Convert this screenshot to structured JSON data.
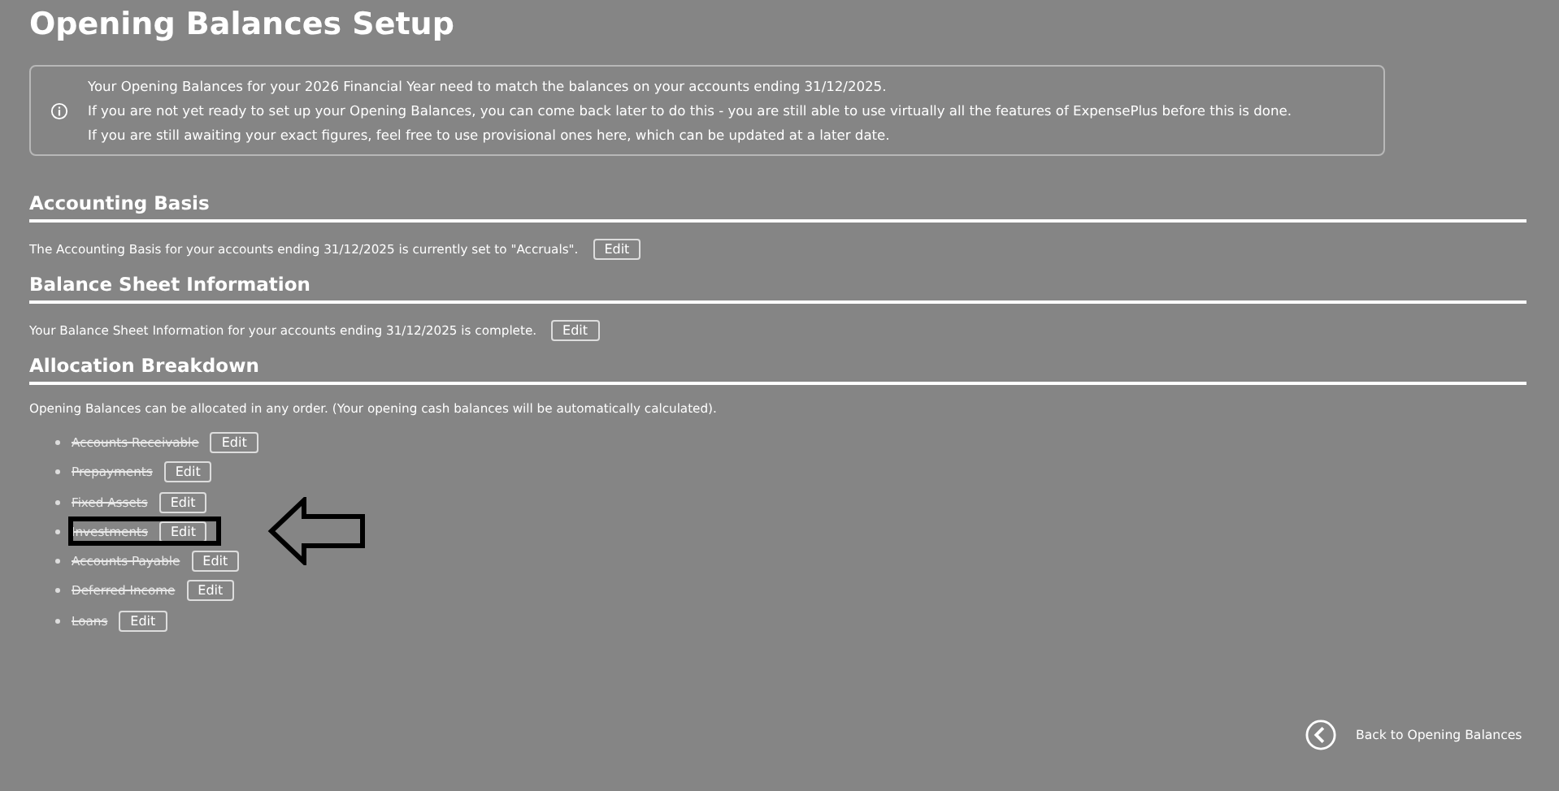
{
  "title": "Opening Balances Setup",
  "info": {
    "lines": [
      "Your Opening Balances for your 2026 Financial Year need to match the balances on your accounts ending 31/12/2025.",
      "If you are not yet ready to set up your Opening Balances, you can come back later to do this - you are still able to use virtually all the features of ExpensePlus before this is done.",
      "If you are still awaiting your exact figures, feel free to use provisional ones here, which can be updated at a later date."
    ]
  },
  "sections": [
    {
      "heading": "Accounting Basis",
      "text": "The Accounting Basis for your accounts ending 31/12/2025 is currently set to \"Accruals\".",
      "button": "Edit"
    },
    {
      "heading": "Balance Sheet Information",
      "text": "Your Balance Sheet Information for your accounts ending 31/12/2025 is complete.",
      "button": "Edit"
    },
    {
      "heading": "Allocation Breakdown",
      "text": "Opening Balances can be allocated in any order. (Your opening cash balances will be automatically calculated).",
      "items": [
        {
          "label": "Accounts Receivable",
          "completed": true,
          "highlighted": false,
          "button": "Edit"
        },
        {
          "label": "Prepayments",
          "completed": true,
          "highlighted": false,
          "button": "Edit"
        },
        {
          "label": "Fixed Assets",
          "completed": true,
          "highlighted": false,
          "button": "Edit"
        },
        {
          "label": "Investments",
          "completed": true,
          "highlighted": true,
          "button": "Edit"
        },
        {
          "label": "Accounts Payable",
          "completed": true,
          "highlighted": false,
          "button": "Edit"
        },
        {
          "label": "Deferred Income",
          "completed": true,
          "highlighted": false,
          "button": "Edit"
        },
        {
          "label": "Loans",
          "completed": true,
          "highlighted": false,
          "button": "Edit"
        }
      ]
    }
  ],
  "back_link": "Back to Opening Balances"
}
